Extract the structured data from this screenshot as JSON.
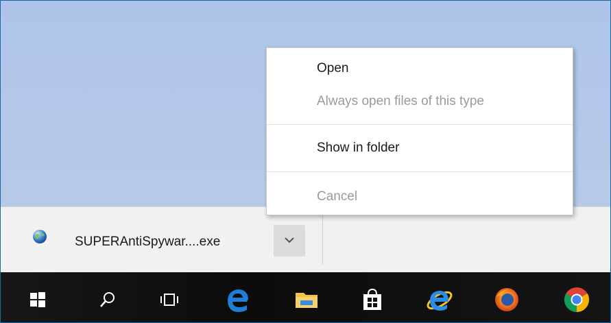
{
  "context_menu": {
    "items": [
      {
        "label": "Open",
        "enabled": true
      },
      {
        "label": "Always open files of this type",
        "enabled": false
      },
      {
        "label": "Show in folder",
        "enabled": true
      },
      {
        "label": "Cancel",
        "enabled": false
      }
    ]
  },
  "download_shelf": {
    "file_name": "SUPERAntiSpywar....exe",
    "file_icon": "globe-icon",
    "dropdown_icon": "chevron-down-icon"
  },
  "taskbar": {
    "icons": [
      "windows-start-icon",
      "search-icon",
      "task-view-icon",
      "edge-icon",
      "file-explorer-icon",
      "store-icon",
      "internet-explorer-icon",
      "firefox-icon",
      "chrome-icon"
    ]
  },
  "colors": {
    "page_background": "#b3c7ea",
    "shelf_background": "#f1f1f1",
    "taskbar_background": "#121212",
    "edge_blue": "#1f7fd6",
    "disabled_text": "#9a9a9a"
  }
}
